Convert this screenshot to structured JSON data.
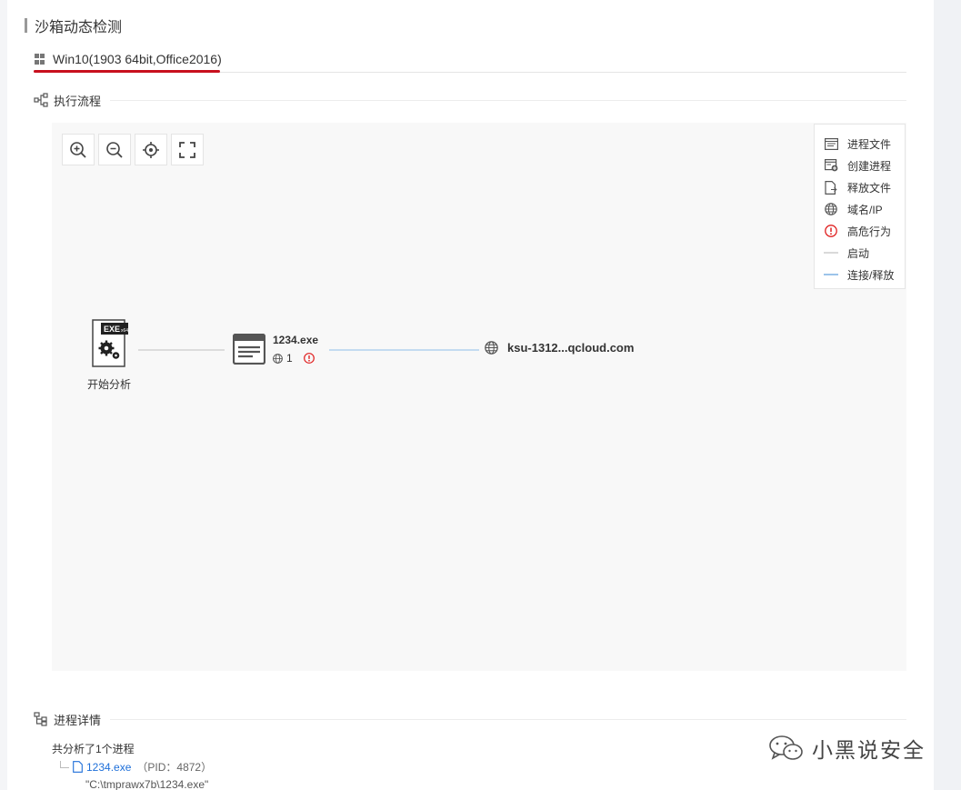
{
  "section": {
    "title": "沙箱动态检测"
  },
  "tabs": [
    {
      "label": "Win10(1903 64bit,Office2016)",
      "active": true,
      "icon": "windows-icon"
    }
  ],
  "execution_flow": {
    "title": "执行流程",
    "toolbar": {
      "zoom_in": "zoom-in-icon",
      "zoom_out": "zoom-out-icon",
      "locate": "crosshair-icon",
      "fullscreen": "fullscreen-icon"
    },
    "legend": [
      {
        "label": "进程文件",
        "icon": "process-file-icon"
      },
      {
        "label": "创建进程",
        "icon": "create-process-icon"
      },
      {
        "label": "释放文件",
        "icon": "release-file-icon"
      },
      {
        "label": "域名/IP",
        "icon": "globe-icon"
      },
      {
        "label": "高危行为",
        "icon": "alert-icon"
      },
      {
        "label": "启动",
        "icon": "start-line"
      },
      {
        "label": "连接/释放",
        "icon": "connect-line"
      }
    ],
    "nodes": {
      "start": {
        "label": "开始分析",
        "badge": "EXE"
      },
      "process": {
        "name": "1234.exe",
        "network_count": "1"
      },
      "domain": {
        "name": "ksu-1312...qcloud.com"
      }
    },
    "colors": {
      "start_line": "#d9d9d9",
      "connect_line": "#b7d3ee",
      "alert": "#e02020",
      "tab_underline": "#c8101e"
    }
  },
  "process_details": {
    "title": "进程详情",
    "summary": "共分析了1个进程",
    "processes": [
      {
        "name": "1234.exe",
        "pid": "（PID：4872）",
        "cmdline": "\"C:\\tmprawx7b\\1234.exe\""
      }
    ]
  },
  "watermark": {
    "text": "小黑说安全"
  }
}
